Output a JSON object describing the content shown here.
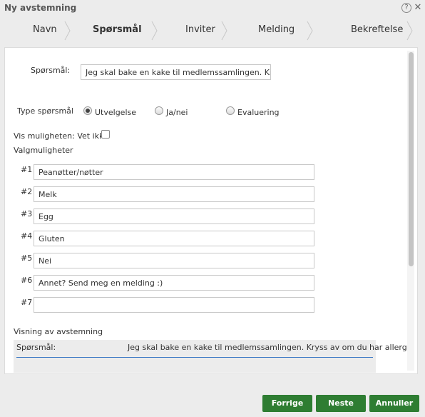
{
  "window": {
    "title": "Ny avstemning"
  },
  "steps": [
    {
      "label": "Navn"
    },
    {
      "label": "Spørsmål"
    },
    {
      "label": "Inviter"
    },
    {
      "label": "Melding"
    },
    {
      "label": "Bekreftelse"
    }
  ],
  "question": {
    "label": "Spørsmål:",
    "value": "Jeg skal bake en kake til medlemssamlingen. Kryss av om du har allergi!"
  },
  "question_type": {
    "label": "Type spørsmål",
    "options": [
      "Utvelgelse",
      "Ja/nei",
      "Evaluering"
    ],
    "selected": "Utvelgelse"
  },
  "dont_know": {
    "label": "Vis muligheten: Vet ikke",
    "checked": false
  },
  "choices": {
    "label": "Valgmuligheter",
    "items": [
      {
        "num": "#1",
        "value": "Peanøtter/nøtter"
      },
      {
        "num": "#2",
        "value": "Melk"
      },
      {
        "num": "#3",
        "value": "Egg"
      },
      {
        "num": "#4",
        "value": "Gluten"
      },
      {
        "num": "#5",
        "value": "Nei"
      },
      {
        "num": "#6",
        "value": "Annet? Send meg en melding :)"
      },
      {
        "num": "#7",
        "value": ""
      }
    ]
  },
  "preview": {
    "label": "Visning av avstemning",
    "question_label": "Spørsmål:",
    "question_text": "Jeg skal bake en kake til medlemssamlingen. Kryss av om du har allergi!"
  },
  "buttons": {
    "prev": "Forrige",
    "next": "Neste",
    "cancel": "Annuller"
  },
  "colors": {
    "button": "#2e7d32",
    "accent_line": "#3b78c4"
  }
}
